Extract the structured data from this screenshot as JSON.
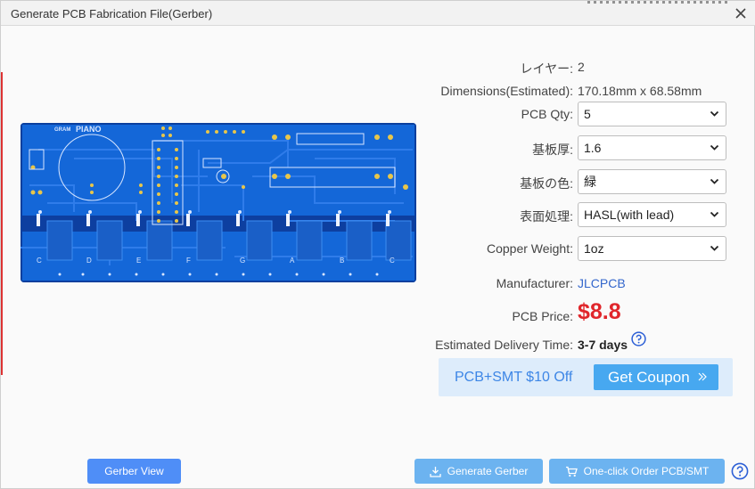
{
  "window": {
    "title": "Generate PCB Fabrication File(Gerber)"
  },
  "board": {
    "brand_a": "GRAM",
    "brand_b": "PIANO",
    "keys": [
      "C",
      "D",
      "E",
      "F",
      "G",
      "A",
      "B",
      "C"
    ],
    "colors": {
      "board": "#1467d8",
      "edge": "#0b3f9e",
      "trace": "#2a7ae8",
      "pad": "#e8c64a"
    }
  },
  "form": {
    "layers": {
      "label": "レイヤー:",
      "value": "2"
    },
    "dimensions": {
      "label": "Dimensions(Estimated):",
      "value": "170.18mm x 68.58mm"
    },
    "pcb_qty": {
      "label": "PCB Qty:",
      "value": "5"
    },
    "thickness": {
      "label": "基板厚:",
      "value": "1.6"
    },
    "color": {
      "label": "基板の色:",
      "value": "緑"
    },
    "finish": {
      "label": "表面処理:",
      "value": "HASL(with lead)"
    },
    "copper": {
      "label": "Copper Weight:",
      "value": "1oz"
    },
    "manufacturer": {
      "label": "Manufacturer:",
      "value": "JLCPCB"
    },
    "price": {
      "label": "PCB Price:",
      "value": "$8.8"
    },
    "delivery": {
      "label": "Estimated Delivery Time:",
      "value": "3-7 days"
    }
  },
  "coupon": {
    "text": "PCB+SMT $10 Off",
    "button": "Get Coupon"
  },
  "footer": {
    "gerber_view": "Gerber View",
    "generate_gerber": "Generate Gerber",
    "order": "One-click Order PCB/SMT"
  },
  "colors": {
    "accent": "#4f8ef7",
    "price": "#e0262b",
    "link": "#3366cc"
  }
}
